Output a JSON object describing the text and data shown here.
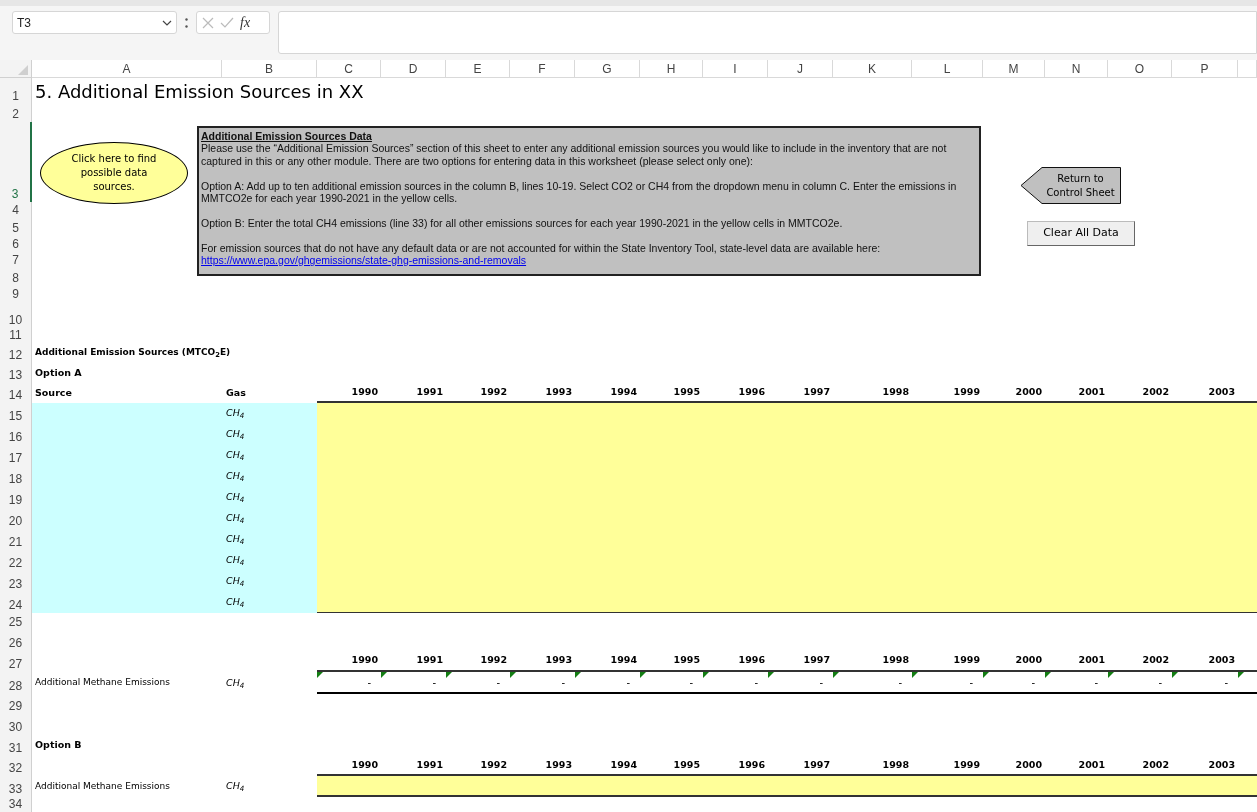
{
  "formula_bar": {
    "name_box": "T3",
    "function_label": "fx"
  },
  "column_headers": [
    "A",
    "B",
    "C",
    "D",
    "E",
    "F",
    "G",
    "H",
    "I",
    "J",
    "K",
    "L",
    "M",
    "N",
    "O",
    "P"
  ],
  "row_headers": [
    "1",
    "2",
    "3",
    "4",
    "5",
    "6",
    "7",
    "8",
    "9",
    "10",
    "11",
    "12",
    "13",
    "14",
    "15",
    "16",
    "17",
    "18",
    "19",
    "20",
    "21",
    "22",
    "23",
    "24",
    "25",
    "26",
    "27",
    "28",
    "29",
    "30",
    "31",
    "32",
    "33",
    "34"
  ],
  "title": "5. Additional Emission Sources in XX",
  "data_sources_button": "Click here to find possible data sources.",
  "instructions": {
    "heading": "Additional Emission Sources Data",
    "paragraphs": [
      "Please use the “Additional Emission Sources” section of this sheet to enter any additional emission sources you would like to include in the inventory that are not captured in this or any other module. There are two options for entering data in this worksheet (please select only one):",
      "Option A: Add up to ten additional emission sources in the column B, lines 10-19. Select CO2 or CH4 from the dropdown menu in column C. Enter the emissions in MMTCO2e for each year 1990-2021 in the yellow cells.",
      "Option B: Enter the total CH4 emissions (line 33) for all other emissions sources for each year 1990-2021 in the yellow cells in MMTCO2e.",
      "For emission sources that do not have any default data or are not accounted for within the State Inventory Tool, state-level data are available here:"
    ],
    "link": "https://www.epa.gov/ghgemissions/state-ghg-emissions-and-removals"
  },
  "return_button": "Return to Control Sheet",
  "clear_button": "Clear All Data",
  "section_title": "Additional Emission Sources (MTCO$_{2}$E)",
  "option_a": {
    "label": "Option A",
    "source_header": "Source",
    "gas_header": "Gas",
    "years": [
      "1990",
      "1991",
      "1992",
      "1993",
      "1994",
      "1995",
      "1996",
      "1997",
      "1998",
      "1999",
      "2000",
      "2001",
      "2002",
      "2003"
    ],
    "rows": [
      {
        "gas": "CH$_{4}$"
      },
      {
        "gas": "CH$_{4}$"
      },
      {
        "gas": "CH$_{4}$"
      },
      {
        "gas": "CH$_{4}$"
      },
      {
        "gas": "CH$_{4}$"
      },
      {
        "gas": "CH$_{4}$"
      },
      {
        "gas": "CH$_{4}$"
      },
      {
        "gas": "CH$_{4}$"
      },
      {
        "gas": "CH$_{4}$"
      },
      {
        "gas": "CH$_{4}$"
      }
    ]
  },
  "summary": {
    "years": [
      "1990",
      "1991",
      "1992",
      "1993",
      "1994",
      "1995",
      "1996",
      "1997",
      "1998",
      "1999",
      "2000",
      "2001",
      "2002",
      "2003"
    ],
    "label": "Additional Methane Emissions",
    "gas": "CH$_{4}$",
    "values": [
      "-",
      "-",
      "-",
      "-",
      "-",
      "-",
      "-",
      "-",
      "-",
      "-",
      "-",
      "-",
      "-",
      "-"
    ]
  },
  "option_b": {
    "label": "Option B",
    "years": [
      "1990",
      "1991",
      "1992",
      "1993",
      "1994",
      "1995",
      "1996",
      "1997",
      "1998",
      "1999",
      "2000",
      "2001",
      "2002",
      "2003"
    ],
    "row_label": "Additional Methane Emissions",
    "gas": "CH$_{4}$"
  }
}
